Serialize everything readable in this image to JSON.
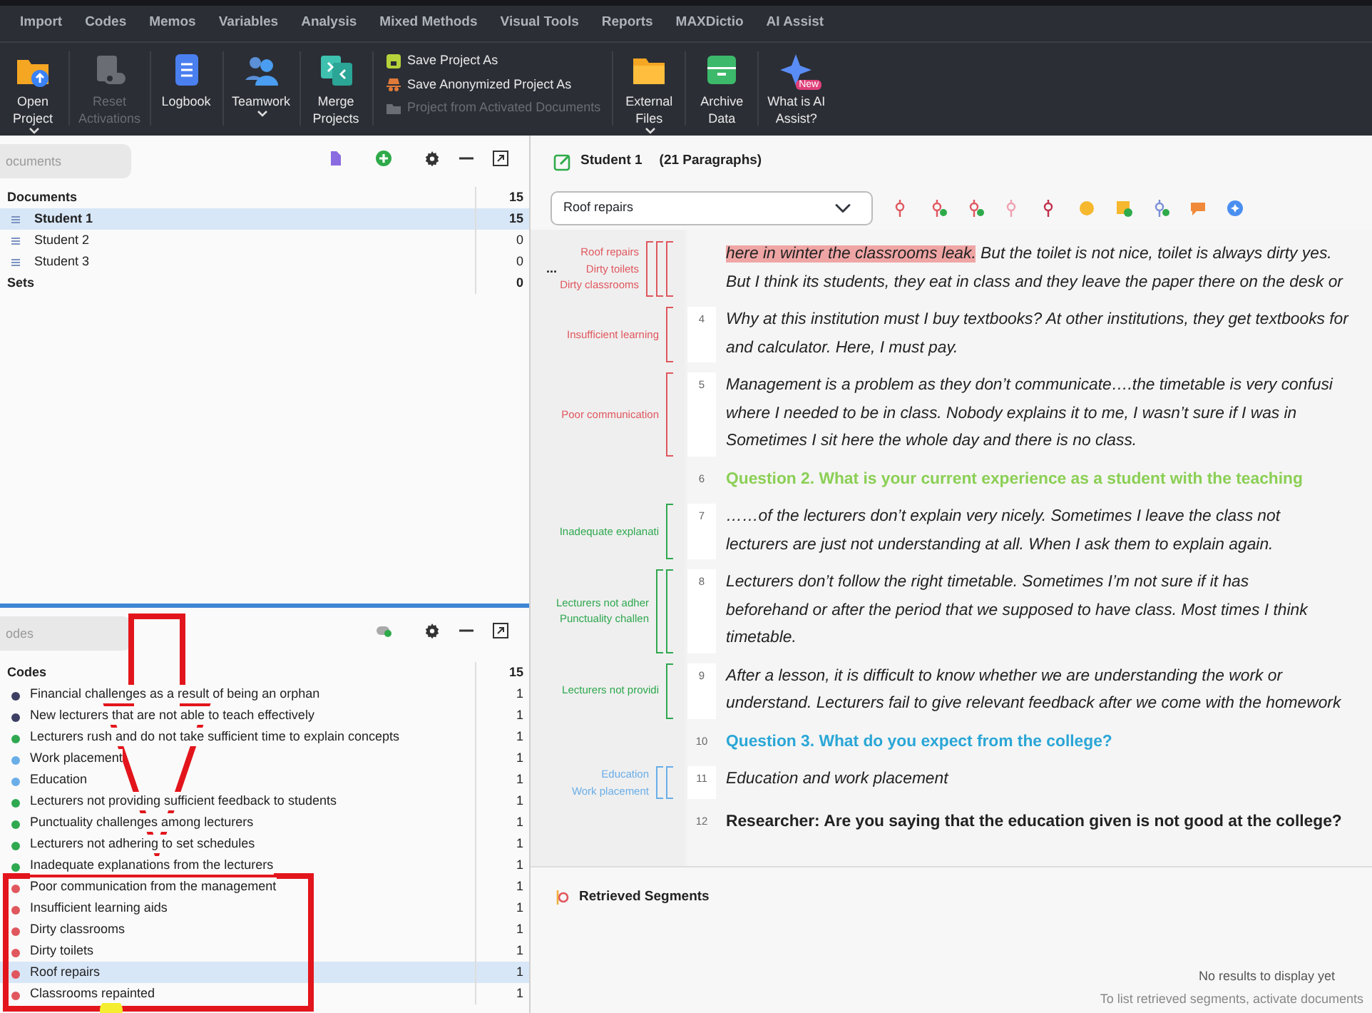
{
  "menu": [
    {
      "label": "Import"
    },
    {
      "label": "Codes"
    },
    {
      "label": "Memos"
    },
    {
      "label": "Variables"
    },
    {
      "label": "Analysis"
    },
    {
      "label": "Mixed Methods"
    },
    {
      "label": "Visual Tools"
    },
    {
      "label": "Reports"
    },
    {
      "label": "MAXDictio"
    },
    {
      "label": "AI Assist"
    }
  ],
  "ribbon": [
    {
      "kind": "big",
      "label_lines": [
        "Open",
        "Project"
      ],
      "caret": true,
      "disabled": false
    },
    {
      "kind": "big",
      "label_lines": [
        "Reset",
        "Activations"
      ],
      "caret": false,
      "disabled": true
    },
    {
      "kind": "big",
      "label_lines": [
        "Logbook"
      ],
      "caret": false,
      "disabled": false
    },
    {
      "kind": "big",
      "label_lines": [
        "Teamwork"
      ],
      "caret": true,
      "disabled": false
    },
    {
      "kind": "big",
      "label_lines": [
        "Merge",
        "Projects"
      ],
      "caret": false,
      "disabled": false
    },
    {
      "kind": "stack",
      "items": [
        {
          "label": "Save Project As",
          "disabled": false
        },
        {
          "label": "Save Anonymized Project As",
          "disabled": false
        },
        {
          "label": "Project from Activated Documents",
          "disabled": true
        }
      ]
    },
    {
      "kind": "big",
      "label_lines": [
        "External",
        "Files"
      ],
      "caret": true,
      "disabled": false
    },
    {
      "kind": "big",
      "label_lines": [
        "Archive",
        "Data"
      ],
      "caret": false,
      "disabled": false
    },
    {
      "kind": "big",
      "label_lines": [
        "What is AI",
        "Assist?"
      ],
      "caret": false,
      "disabled": false,
      "badge": "New"
    }
  ],
  "documents": {
    "search": {
      "placeholder": "ocuments"
    },
    "rows": [
      {
        "kind": "root",
        "label": "Documents",
        "count": "15",
        "selected": false
      },
      {
        "kind": "doc",
        "label": "Student 1",
        "count": "15",
        "selected": true
      },
      {
        "kind": "doc",
        "label": "Student 2",
        "count": "0",
        "selected": false
      },
      {
        "kind": "doc",
        "label": "Student 3",
        "count": "0",
        "selected": false
      },
      {
        "kind": "root",
        "label": "Sets",
        "count": "0",
        "selected": false
      }
    ]
  },
  "codes": {
    "search": {
      "placeholder": "odes"
    },
    "root": {
      "label": "Codes",
      "count": "15"
    },
    "rows": [
      {
        "label": "Financial challenges as a result of being an orphan",
        "count": "1",
        "color": "#3d3f63",
        "selected": false
      },
      {
        "label": "New lecturers that are not able to teach effectively",
        "count": "1",
        "color": "#3d3f63",
        "selected": false
      },
      {
        "label": "Lecturers rush and do not take sufficient time to explain concepts",
        "count": "1",
        "color": "#2fa84f",
        "selected": false
      },
      {
        "label": "Work placement",
        "count": "1",
        "color": "#6aaee8",
        "selected": false
      },
      {
        "label": "Education",
        "count": "1",
        "color": "#6aaee8",
        "selected": false
      },
      {
        "label": "Lecturers not providing sufficient feedback to students",
        "count": "1",
        "color": "#2fa84f",
        "selected": false
      },
      {
        "label": "Punctuality challenges among lecturers",
        "count": "1",
        "color": "#2fa84f",
        "selected": false
      },
      {
        "label": "Lecturers not adhering to set schedules",
        "count": "1",
        "color": "#2fa84f",
        "selected": false
      },
      {
        "label": "Inadequate explanations from the lecturers",
        "count": "1",
        "color": "#2fa84f",
        "selected": false
      },
      {
        "label": "Poor communication from the management",
        "count": "1",
        "color": "#e0575e",
        "selected": false
      },
      {
        "label": "Insufficient learning aids",
        "count": "1",
        "color": "#e0575e",
        "selected": false
      },
      {
        "label": "Dirty classrooms",
        "count": "1",
        "color": "#e0575e",
        "selected": false
      },
      {
        "label": "Dirty toilets",
        "count": "1",
        "color": "#e0575e",
        "selected": false
      },
      {
        "label": "Roof repairs",
        "count": "1",
        "color": "#e0575e",
        "selected": true
      },
      {
        "label": "Classrooms repainted",
        "count": "1",
        "color": "#e0575e",
        "selected": false
      }
    ]
  },
  "document_browser": {
    "title": "Student 1",
    "subtitle": "(21 Paragraphs)",
    "code_select": "Roof repairs",
    "paragraphs": [
      {
        "kind": "answer",
        "overflow": "...",
        "codes": [
          {
            "label": "Roof repairs",
            "color": "#e0575e"
          },
          {
            "label": "Dirty toilets",
            "color": "#e0575e"
          },
          {
            "label": "Dirty classrooms",
            "color": "#e0575e"
          }
        ],
        "lines": [
          [
            {
              "text": "here in winter the classrooms leak.",
              "highlighted": true
            },
            {
              "text": " But the toilet is not nice, toilet is always dirty yes.",
              "highlighted": false
            }
          ],
          "But I think its students, they eat in class and they leave the paper there on the desk or"
        ]
      },
      {
        "kind": "answer",
        "number": "4",
        "codes": [
          {
            "label": "Insufficient learning",
            "color": "#e0575e"
          }
        ],
        "lines": [
          "Why at this institution must I buy textbooks? At other institutions, they get textbooks for",
          "and calculator. Here, I must pay."
        ]
      },
      {
        "kind": "answer",
        "number": "5",
        "codes": [
          {
            "label": "Poor communication",
            "color": "#e0575e"
          }
        ],
        "lines": [
          "Management is a problem as they don’t communicate….the timetable is very confusi",
          "where I needed to be in class. Nobody explains it to me, I wasn’t sure if I was in",
          "Sometimes I sit here the whole day and there is no class."
        ]
      },
      {
        "kind": "question",
        "number": "6",
        "color": "#8bcf55",
        "lines": [
          "Question 2. What is your current experience as a student with the teaching"
        ]
      },
      {
        "kind": "answer",
        "number": "7",
        "codes": [
          {
            "label": "Inadequate explanati",
            "color": "#2fa84f"
          }
        ],
        "lines": [
          "……of the lecturers don’t explain very nicely. Sometimes I leave the class not",
          "lecturers are just not understanding at all. When I ask them to explain again."
        ]
      },
      {
        "kind": "answer",
        "number": "8",
        "codes": [
          {
            "label": "Lecturers not adher",
            "color": "#2fa84f"
          },
          {
            "label": "Punctuality challen",
            "color": "#2fa84f"
          }
        ],
        "lines": [
          "Lecturers don’t follow the right timetable. Sometimes I’m not sure if it has",
          "beforehand or after the period that we supposed to have class. Most times I think",
          "timetable."
        ]
      },
      {
        "kind": "answer",
        "number": "9",
        "codes": [
          {
            "label": "Lecturers not providi",
            "color": "#2fa84f"
          }
        ],
        "lines": [
          "After a lesson, it is difficult to know whether we are understanding the work or",
          "understand. Lecturers fail to give relevant feedback after we come with the homework"
        ]
      },
      {
        "kind": "question",
        "number": "10",
        "color": "#2aa6d6",
        "lines": [
          "Question 3. What do you expect from the college?"
        ]
      },
      {
        "kind": "answer",
        "number": "11",
        "codes": [
          {
            "label": "Education",
            "color": "#6aaee8"
          },
          {
            "label": "Work placement",
            "color": "#6aaee8"
          }
        ],
        "lines": [
          "Education and work placement"
        ]
      },
      {
        "kind": "researcher",
        "number": "12",
        "lines": [
          "Researcher: Are you saying that the education given is not good at the college?"
        ]
      }
    ]
  },
  "retrieved": {
    "title": "Retrieved Segments",
    "empty": "No results to display yet",
    "hint": "To list retrieved segments, activate documents"
  },
  "annotations": [
    {
      "kind": "arrow"
    },
    {
      "kind": "frame"
    },
    {
      "kind": "cursor-highlight"
    }
  ]
}
